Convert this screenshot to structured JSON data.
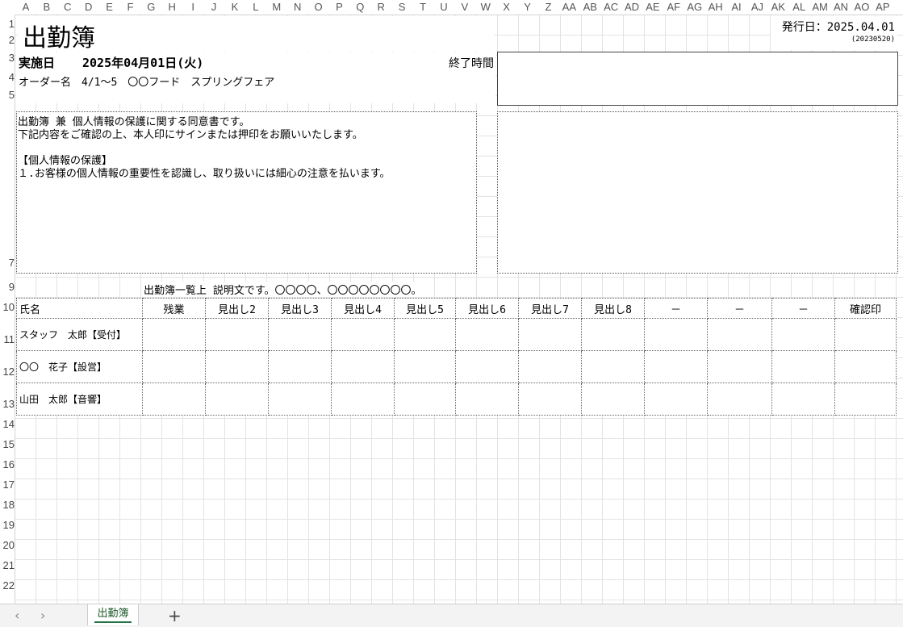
{
  "columns": [
    "A",
    "B",
    "C",
    "D",
    "E",
    "F",
    "G",
    "H",
    "I",
    "J",
    "K",
    "L",
    "M",
    "N",
    "O",
    "P",
    "Q",
    "R",
    "S",
    "T",
    "U",
    "V",
    "W",
    "X",
    "Y",
    "Z",
    "AA",
    "AB",
    "AC",
    "AD",
    "AE",
    "AF",
    "AG",
    "AH",
    "AI",
    "AJ",
    "AK",
    "AL",
    "AM",
    "AN",
    "AO",
    "AP"
  ],
  "rows": [
    "1",
    "2",
    "3",
    "4",
    "5",
    "7",
    "9",
    "10",
    "11",
    "12",
    "13",
    "14",
    "15",
    "16",
    "17",
    "18",
    "19",
    "20",
    "21",
    "22"
  ],
  "doc": {
    "title": "出勤簿",
    "issue_date": "発行日：2025.04.01",
    "code": "(20230520)",
    "date_label": "実施日",
    "date_value": "2025年04月01日(火)",
    "end_time_label": "終了時間",
    "order_label": "オーダー名",
    "order_value": "4/1～5　〇〇フード　スプリングフェア",
    "consent_line1": "出勤簿 兼 個人情報の保護に関する同意書です。",
    "consent_line2": "下記内容をご確認の上、本人印にサインまたは押印をお願いいたします。",
    "consent_heading": "【個人情報の保護】",
    "consent_item1": "１.お客様の個人情報の重要性を認識し、取り扱いには細心の注意を払います。",
    "table_caption": "出勤簿一覧上 説明文です。〇〇〇〇、〇〇〇〇〇〇〇〇。"
  },
  "table": {
    "headers": [
      "氏名",
      "残業",
      "見出し2",
      "見出し3",
      "見出し4",
      "見出し5",
      "見出し6",
      "見出し7",
      "見出し8",
      "－",
      "－",
      "－",
      "確認印"
    ],
    "staff": [
      "スタッフ　太郎【受付】",
      "〇〇　花子【設営】",
      "山田　太郎【音響】"
    ]
  },
  "sheet": {
    "tab_label": "出勤簿",
    "prev": "‹",
    "next": "›",
    "add": "+"
  }
}
